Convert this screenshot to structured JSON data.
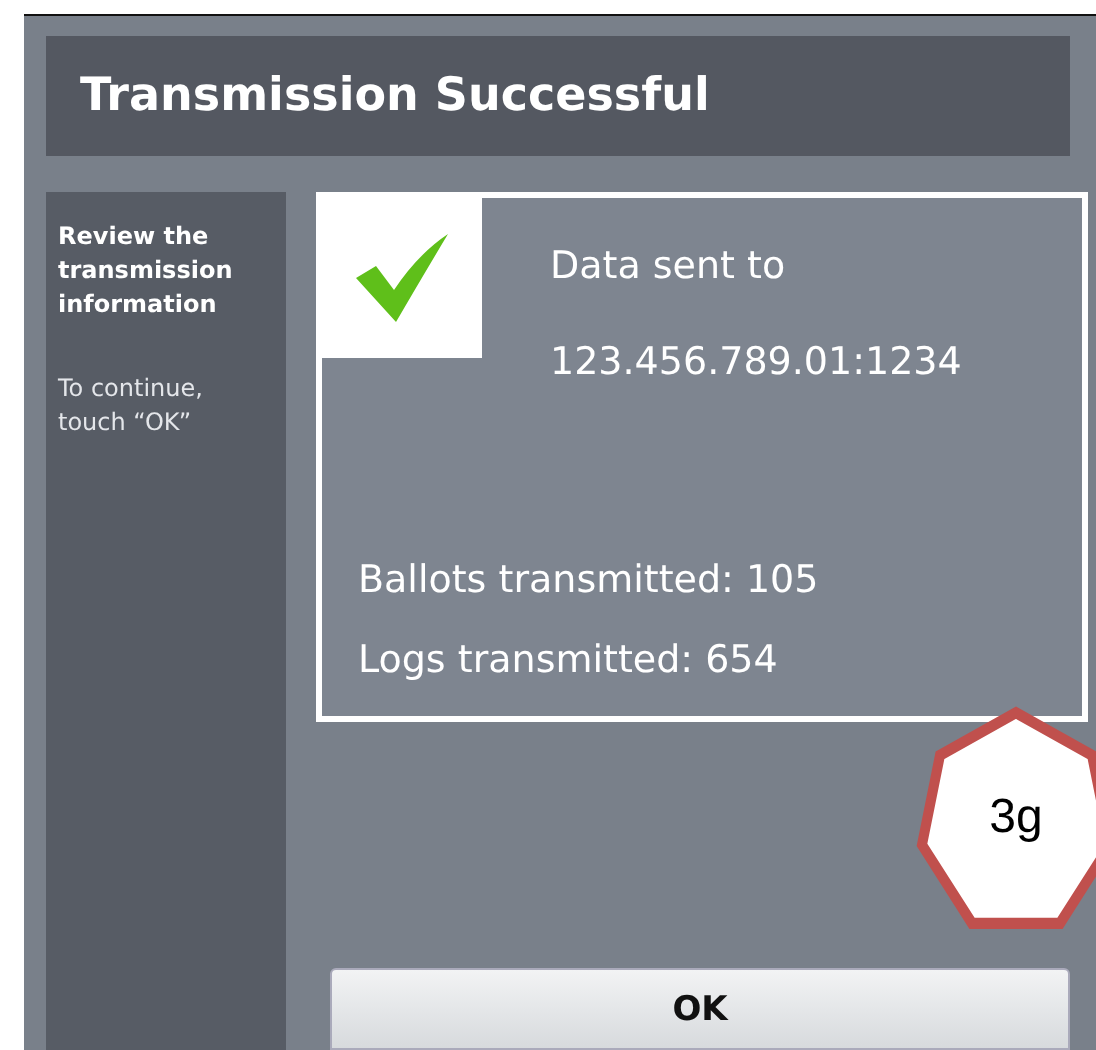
{
  "title": "Transmission Successful",
  "sidebar": {
    "heading": "Review the transmission information",
    "hint": "To continue, touch “OK”"
  },
  "result": {
    "lines": [
      "Data sent to",
      "123.456.789.01:1234"
    ],
    "counts": [
      "Ballots transmitted: 105",
      "Logs transmitted: 654"
    ]
  },
  "badge": "3g",
  "buttons": [
    "OK"
  ]
}
